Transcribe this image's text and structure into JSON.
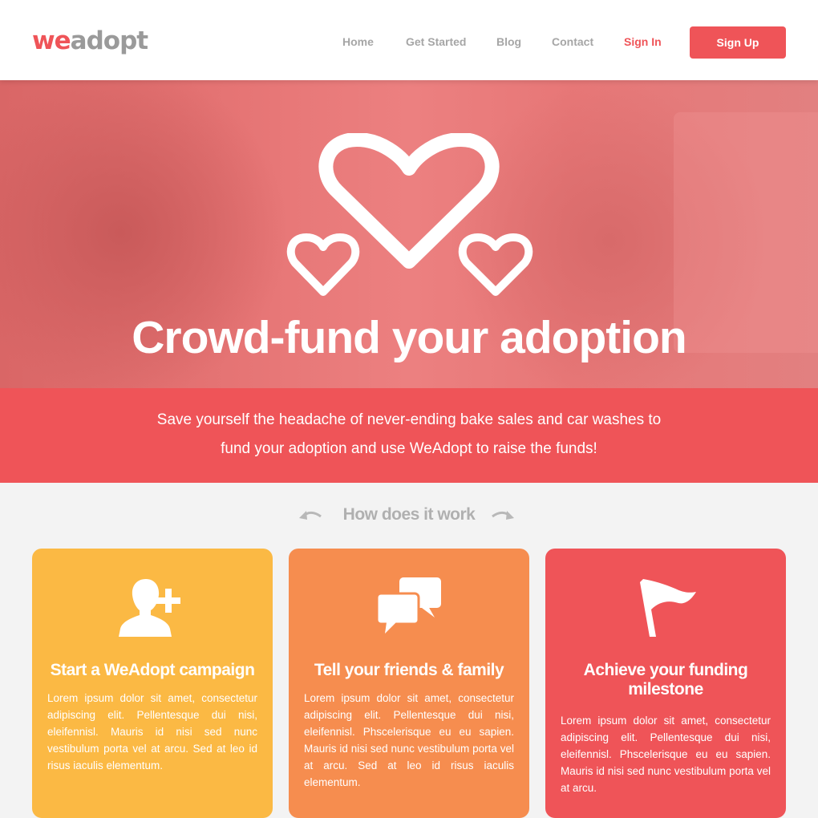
{
  "brand": {
    "we": "we",
    "adopt": "adopt"
  },
  "nav": {
    "items": [
      "Home",
      "Get Started",
      "Blog",
      "Contact"
    ],
    "sign_in": "Sign In",
    "sign_up": "Sign Up"
  },
  "hero": {
    "title": "Crowd-fund your adoption"
  },
  "band": {
    "line1": "Save yourself the headache of never-ending bake sales and car washes to",
    "line2": "fund your adoption and use WeAdopt to raise the funds!"
  },
  "how": {
    "title": "How does it work"
  },
  "cards": [
    {
      "icon": "add-user-icon",
      "title": "Start a WeAdopt campaign",
      "text": "Lorem ipsum dolor sit amet, consectetur adipiscing elit. Pellentesque dui nisi, eleifennisl. Mauris id nisi sed nunc vestibulum porta vel at arcu. Sed at leo id risus iaculis elementum."
    },
    {
      "icon": "chat-bubbles-icon",
      "title": "Tell your friends & family",
      "text": "Lorem ipsum dolor sit amet, consectetur adipiscing elit. Pellentesque dui nisi, eleifennisl. Phscelerisque eu eu sapien. Mauris id nisi sed nunc vestibulum porta vel at arcu. Sed at leo id risus iaculis elementum."
    },
    {
      "icon": "flag-icon",
      "title": "Achieve your funding milestone",
      "text": "Lorem ipsum dolor sit amet, consectetur adipiscing elit. Pellentesque dui nisi, eleifennisl. Phscelerisque eu eu sapien. Mauris id nisi sed nunc vestibulum porta vel at arcu."
    }
  ],
  "colors": {
    "brand_red": "#ef5458",
    "yellow": "#fbb944",
    "orange": "#f68d4f",
    "grey_text": "#a6a6a6"
  }
}
